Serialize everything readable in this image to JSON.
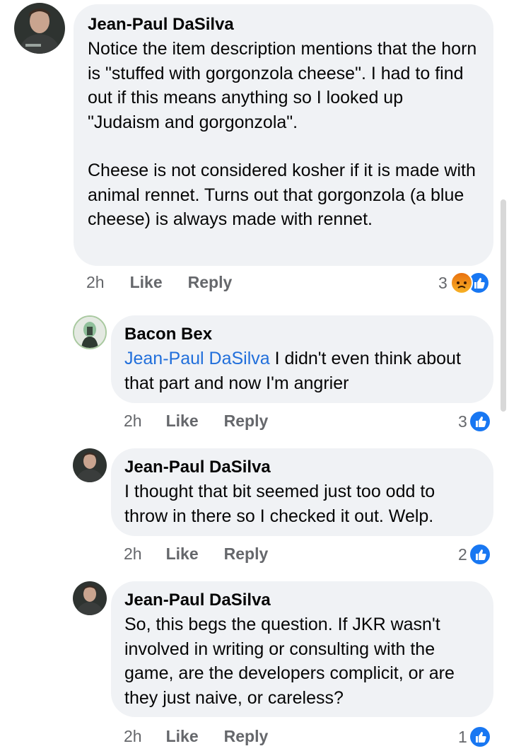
{
  "comments": [
    {
      "author": "Jean-Paul DaSilva",
      "paragraphs": [
        "Notice the item description mentions that the horn is \"stuffed with gorgonzola cheese\". I had to find out if this means anything so I looked up \"Judaism and gorgonzola\".",
        "Cheese is not considered kosher if it is made with animal rennet. Turns out that gorgonzola (a blue cheese) is always made with rennet."
      ],
      "time": "2h",
      "like_label": "Like",
      "reply_label": "Reply",
      "reaction_count": "3"
    },
    {
      "author": "Bacon Bex",
      "mention": "Jean-Paul DaSilva",
      "text": " I didn't even think about that part and now I'm angrier",
      "time": "2h",
      "like_label": "Like",
      "reply_label": "Reply",
      "reaction_count": "3"
    },
    {
      "author": "Jean-Paul DaSilva",
      "text": "I thought that bit seemed just too odd to throw in there so I checked it out. Welp.",
      "time": "2h",
      "like_label": "Like",
      "reply_label": "Reply",
      "reaction_count": "2"
    },
    {
      "author": "Jean-Paul DaSilva",
      "text": "So, this begs the question. If JKR wasn't involved in writing or consulting with the game, are the developers complicit, or are they just naive, or careless?",
      "time": "2h",
      "like_label": "Like",
      "reply_label": "Reply",
      "reaction_count": "1"
    }
  ],
  "colors": {
    "bubble": "#f0f2f5",
    "mention": "#216fdb",
    "meta": "#65676b",
    "like": "#1877f2",
    "angry": "#e9710f"
  },
  "icons": [
    "like-reaction-icon",
    "angry-reaction-icon",
    "avatar"
  ]
}
